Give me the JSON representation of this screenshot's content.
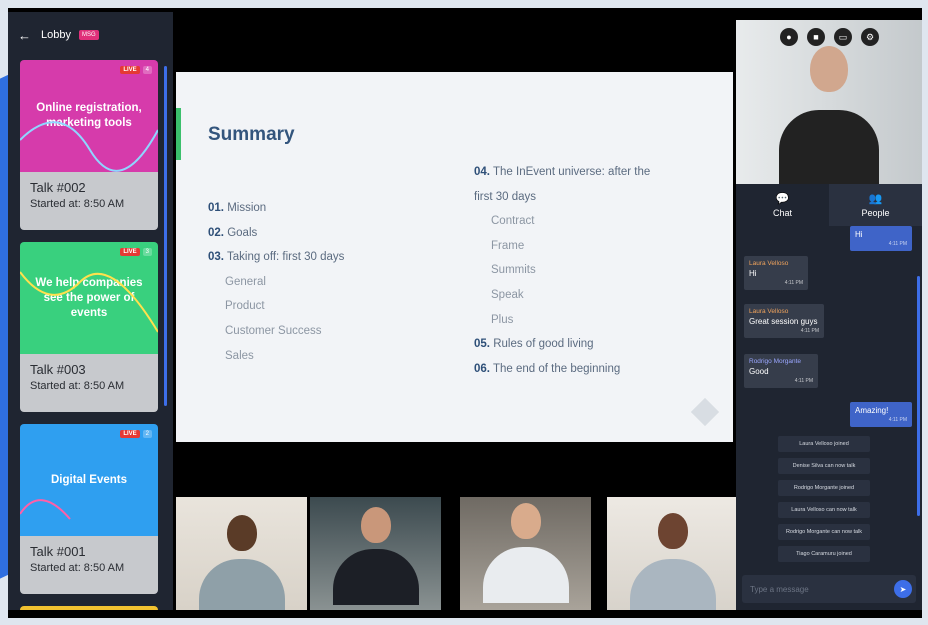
{
  "sidebar": {
    "back_label": "Lobby",
    "badge": "MSG",
    "talks": [
      {
        "title": "Online registration, marketing tools",
        "talk": "Talk #002",
        "started": "Started at: 8:50 AM",
        "live": "LIVE",
        "viewers": "4",
        "color": "#d63bab"
      },
      {
        "title": "We help companies see the power of events",
        "talk": "Talk #003",
        "started": "Started at: 8:50 AM",
        "live": "LIVE",
        "viewers": "3",
        "color": "#39d07e"
      },
      {
        "title": "Digital Events",
        "talk": "Talk #001",
        "started": "Started at: 8:50 AM",
        "live": "LIVE",
        "viewers": "2",
        "color": "#2f9ff0"
      }
    ]
  },
  "slide": {
    "title": "Summary",
    "left": [
      {
        "num": "01.",
        "text": "Mission"
      },
      {
        "num": "02.",
        "text": "Goals"
      },
      {
        "num": "03.",
        "text": "Taking off: first 30 days"
      },
      {
        "sub": "General"
      },
      {
        "sub": "Product"
      },
      {
        "sub": "Customer Success"
      },
      {
        "sub": "Sales"
      }
    ],
    "right": [
      {
        "num": "04.",
        "text": "The InEvent universe: after the"
      },
      {
        "text": "first 30 days"
      },
      {
        "sub": "Contract"
      },
      {
        "sub": "Frame"
      },
      {
        "sub": "Summits"
      },
      {
        "sub": "Speak"
      },
      {
        "sub": "Plus"
      },
      {
        "num": "05.",
        "text": "Rules of good living"
      },
      {
        "num": "06.",
        "text": "The end of the beginning"
      }
    ]
  },
  "tabs": {
    "chat": "Chat",
    "people": "People"
  },
  "chat": {
    "messages": [
      {
        "dir": "out",
        "who": "",
        "text": "Hi",
        "time": "4:11 PM"
      },
      {
        "dir": "in",
        "who": "Laura Velloso",
        "text": "Hi",
        "time": "4:11 PM"
      },
      {
        "dir": "in",
        "who": "Laura Velloso",
        "text": "Great session guys",
        "time": "4:11 PM"
      },
      {
        "dir": "in",
        "who": "Rodrigo Morgante",
        "text": "Good",
        "time": "4:11 PM"
      },
      {
        "dir": "out",
        "who": "",
        "text": "Amazing!",
        "time": "4:11 PM"
      }
    ],
    "system": [
      "Laura Velloso joined",
      "Denise Silva can now talk",
      "Rodrigo Morgante joined",
      "Laura Velloso can now talk",
      "Rodrigo Morgante can now talk",
      "Tiago Caramuru joined"
    ],
    "placeholder": "Type a message"
  }
}
